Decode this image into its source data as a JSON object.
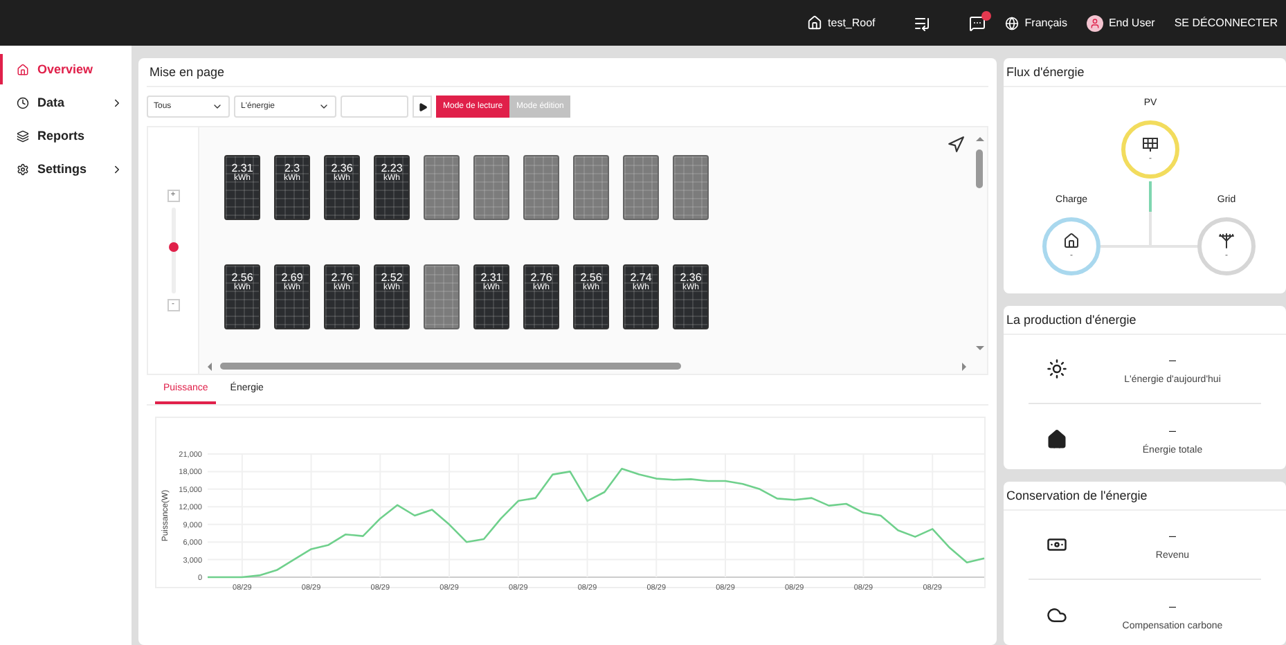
{
  "header": {
    "site": "test_Roof",
    "language": "Français",
    "user": "End User",
    "logout": "SE DÉCONNECTER"
  },
  "sidebar": {
    "items": [
      {
        "label": "Overview",
        "selected": true,
        "has_children": false
      },
      {
        "label": "Data",
        "selected": false,
        "has_children": true
      },
      {
        "label": "Reports",
        "selected": false,
        "has_children": false
      },
      {
        "label": "Settings",
        "selected": false,
        "has_children": true
      }
    ]
  },
  "layout_card": {
    "title": "Mise en page",
    "filters": [
      {
        "value": "Tous"
      },
      {
        "value": "L'énergie"
      }
    ],
    "modes": [
      {
        "label": "Mode de lecture",
        "selected": true
      },
      {
        "label": "Mode édition",
        "selected": false
      }
    ],
    "zoom": {
      "plus": "+",
      "minus": "-",
      "level": 0.55
    },
    "panel_rows": [
      {
        "panels": [
          {
            "kind": "active",
            "value": "2.31",
            "unit": "kWh"
          },
          {
            "kind": "active",
            "value": "2.3",
            "unit": "kWh"
          },
          {
            "kind": "active",
            "value": "2.36",
            "unit": "kWh"
          },
          {
            "kind": "active",
            "value": "2.23",
            "unit": "kWh"
          },
          {
            "kind": "empty"
          },
          {
            "kind": "empty"
          },
          {
            "kind": "empty"
          },
          {
            "kind": "empty"
          },
          {
            "kind": "empty"
          },
          {
            "kind": "empty"
          }
        ]
      },
      {
        "panels": [
          {
            "kind": "active",
            "value": "2.56",
            "unit": "kWh"
          },
          {
            "kind": "active",
            "value": "2.69",
            "unit": "kWh"
          },
          {
            "kind": "active",
            "value": "2.76",
            "unit": "kWh"
          },
          {
            "kind": "active",
            "value": "2.52",
            "unit": "kWh"
          },
          {
            "kind": "empty"
          },
          {
            "kind": "active",
            "value": "2.31",
            "unit": "kWh"
          },
          {
            "kind": "active",
            "value": "2.76",
            "unit": "kWh"
          },
          {
            "kind": "active",
            "value": "2.56",
            "unit": "kWh"
          },
          {
            "kind": "active",
            "value": "2.74",
            "unit": "kWh"
          },
          {
            "kind": "active",
            "value": "2.36",
            "unit": "kWh"
          }
        ]
      }
    ],
    "tabs": [
      {
        "label": "Puissance",
        "selected": true
      },
      {
        "label": "Énergie",
        "selected": false
      }
    ],
    "chart_data": {
      "type": "line",
      "grid": true,
      "ylabel": "Puissance(W)",
      "categories": [
        null,
        null,
        "08/29",
        null,
        null,
        null,
        "08/29",
        null,
        null,
        null,
        "08/29",
        null,
        null,
        null,
        "08/29",
        null,
        null,
        null,
        "08/29",
        null,
        null,
        null,
        "08/29",
        null,
        null,
        null,
        "08/29",
        null,
        null,
        null,
        "08/29",
        null,
        null,
        null,
        "08/29",
        null,
        null,
        null,
        "08/29",
        null,
        null,
        null,
        "08/29",
        null,
        null,
        null
      ],
      "ylim": [
        0,
        21000
      ],
      "yticks": [
        {
          "value": 0,
          "label": "0"
        },
        {
          "value": 3000,
          "label": "3,000"
        },
        {
          "value": 6000,
          "label": "6,000"
        },
        {
          "value": 9000,
          "label": "9,000"
        },
        {
          "value": 12000,
          "label": "12,000"
        },
        {
          "value": 15000,
          "label": "15,000"
        },
        {
          "value": 18000,
          "label": "18,000"
        },
        {
          "value": 21000,
          "label": "21,000"
        }
      ],
      "series": [
        {
          "color": "#6fd08c",
          "values": [
            0,
            0,
            0,
            300,
            1200,
            3000,
            4800,
            5500,
            7300,
            7000,
            10000,
            12300,
            10500,
            11500,
            9000,
            6000,
            6500,
            10000,
            13000,
            13500,
            17500,
            18000,
            13000,
            14500,
            18500,
            17500,
            16800,
            16600,
            16700,
            16400,
            16400,
            15900,
            15000,
            13400,
            13200,
            13500,
            12200,
            12500,
            11000,
            10500,
            8000,
            6900,
            8200,
            5000,
            2500,
            3200
          ]
        }
      ]
    }
  },
  "flow": {
    "title": "Flux d'énergie",
    "nodes": [
      {
        "kind": "pv",
        "label": "PV",
        "value": "-",
        "color": "#f2dc5d"
      },
      {
        "kind": "load",
        "label": "Charge",
        "value": "-",
        "color": "#a9d8ee"
      },
      {
        "kind": "grid",
        "label": "Grid",
        "value": "-",
        "color": "#d6d6d6"
      }
    ]
  },
  "production": {
    "title": "La production d'énergie",
    "items": [
      {
        "value": "–",
        "label": "L'énergie d'aujourd'hui"
      },
      {
        "value": "–",
        "label": "Énergie totale"
      }
    ]
  },
  "conservation": {
    "title": "Conservation de l'énergie",
    "items": [
      {
        "value": "–",
        "label": "Revenu"
      },
      {
        "value": "–",
        "label": "Compensation carbone"
      }
    ]
  }
}
